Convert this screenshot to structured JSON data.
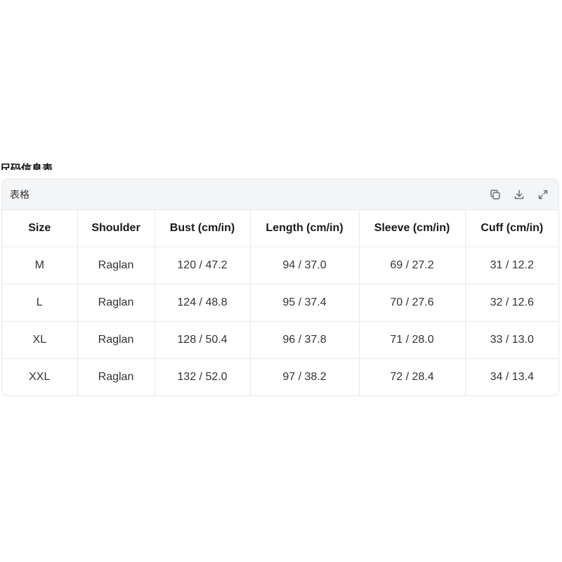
{
  "section_heading": "尺码信息表",
  "table_card": {
    "title": "表格",
    "actions": {
      "copy_icon": "copy-icon",
      "download_icon": "download-icon",
      "expand_icon": "expand-icon"
    },
    "columns": [
      "Size",
      "Shoulder",
      "Bust (cm/in)",
      "Length (cm/in)",
      "Sleeve (cm/in)",
      "Cuff (cm/in)"
    ],
    "rows": [
      [
        "M",
        "Raglan",
        "120 / 47.2",
        "94 / 37.0",
        "69 / 27.2",
        "31 / 12.2"
      ],
      [
        "L",
        "Raglan",
        "124 / 48.8",
        "95 / 37.4",
        "70 / 27.6",
        "32 / 12.6"
      ],
      [
        "XL",
        "Raglan",
        "128 / 50.4",
        "96 / 37.8",
        "71 / 28.0",
        "33 / 13.0"
      ],
      [
        "XXL",
        "Raglan",
        "132 / 52.0",
        "97 / 38.2",
        "72 / 28.4",
        "34 / 13.4"
      ]
    ]
  }
}
